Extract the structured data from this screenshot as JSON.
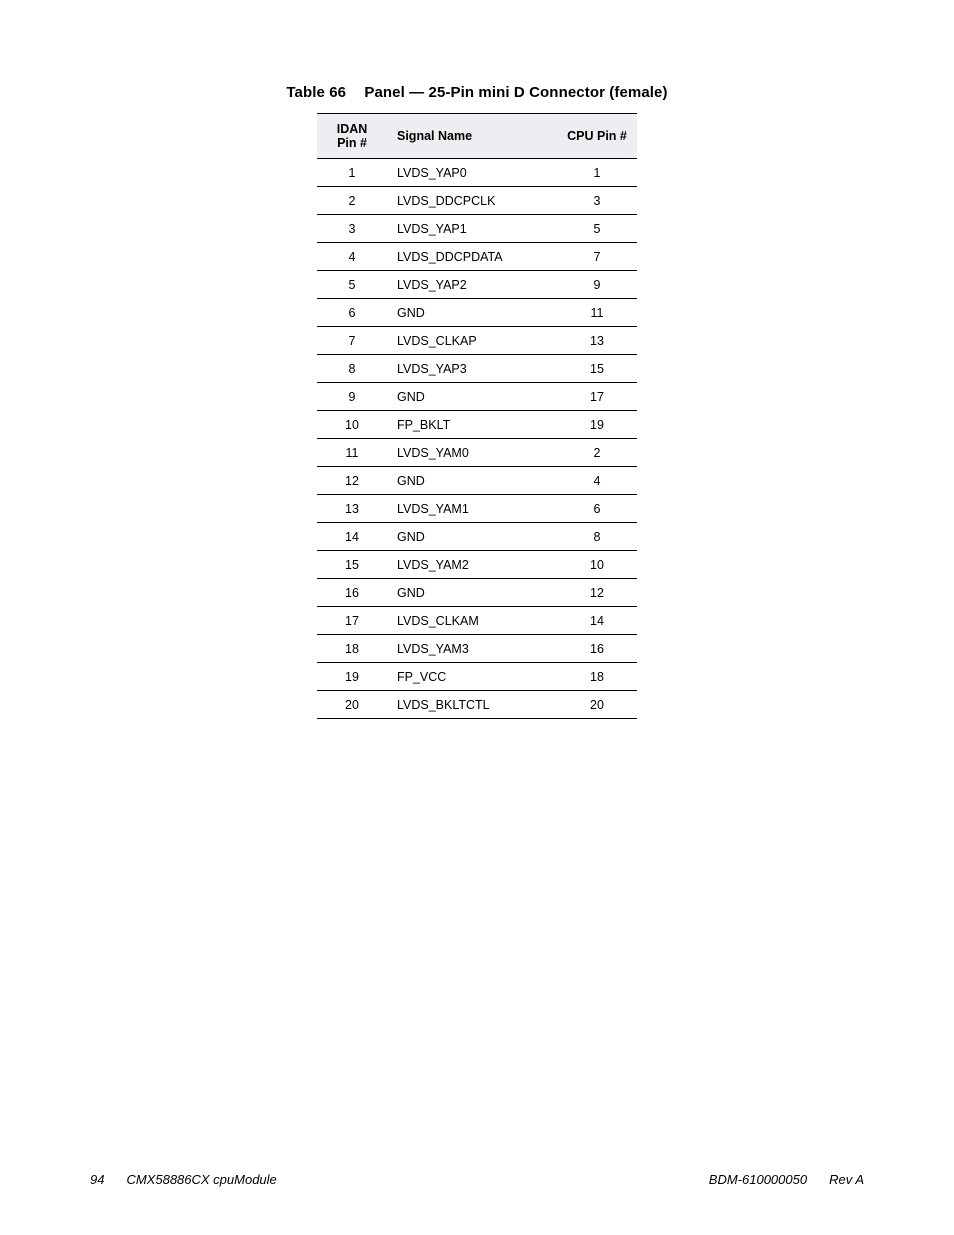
{
  "caption": {
    "label": "Table 66",
    "title": "Panel — 25-Pin mini D Connector (female)"
  },
  "columns": {
    "idan": "IDAN Pin #",
    "signal": "Signal Name",
    "cpu": "CPU Pin #"
  },
  "rows": [
    {
      "idan": "1",
      "signal": "LVDS_YAP0",
      "cpu": "1"
    },
    {
      "idan": "2",
      "signal": "LVDS_DDCPCLK",
      "cpu": "3"
    },
    {
      "idan": "3",
      "signal": "LVDS_YAP1",
      "cpu": "5"
    },
    {
      "idan": "4",
      "signal": "LVDS_DDCPDATA",
      "cpu": "7"
    },
    {
      "idan": "5",
      "signal": "LVDS_YAP2",
      "cpu": "9"
    },
    {
      "idan": "6",
      "signal": "GND",
      "cpu": "11"
    },
    {
      "idan": "7",
      "signal": "LVDS_CLKAP",
      "cpu": "13"
    },
    {
      "idan": "8",
      "signal": "LVDS_YAP3",
      "cpu": "15"
    },
    {
      "idan": "9",
      "signal": "GND",
      "cpu": "17"
    },
    {
      "idan": "10",
      "signal": "FP_BKLT",
      "cpu": "19"
    },
    {
      "idan": "11",
      "signal": "LVDS_YAM0",
      "cpu": "2"
    },
    {
      "idan": "12",
      "signal": "GND",
      "cpu": "4"
    },
    {
      "idan": "13",
      "signal": "LVDS_YAM1",
      "cpu": "6"
    },
    {
      "idan": "14",
      "signal": "GND",
      "cpu": "8"
    },
    {
      "idan": "15",
      "signal": "LVDS_YAM2",
      "cpu": "10"
    },
    {
      "idan": "16",
      "signal": "GND",
      "cpu": "12"
    },
    {
      "idan": "17",
      "signal": "LVDS_CLKAM",
      "cpu": "14"
    },
    {
      "idan": "18",
      "signal": "LVDS_YAM3",
      "cpu": "16"
    },
    {
      "idan": "19",
      "signal": "FP_VCC",
      "cpu": "18"
    },
    {
      "idan": "20",
      "signal": "LVDS_BKLTCTL",
      "cpu": "20"
    }
  ],
  "footer": {
    "page_number": "94",
    "doc_title": "CMX58886CX cpuModule",
    "doc_code": "BDM-610000050",
    "rev": "Rev A"
  }
}
